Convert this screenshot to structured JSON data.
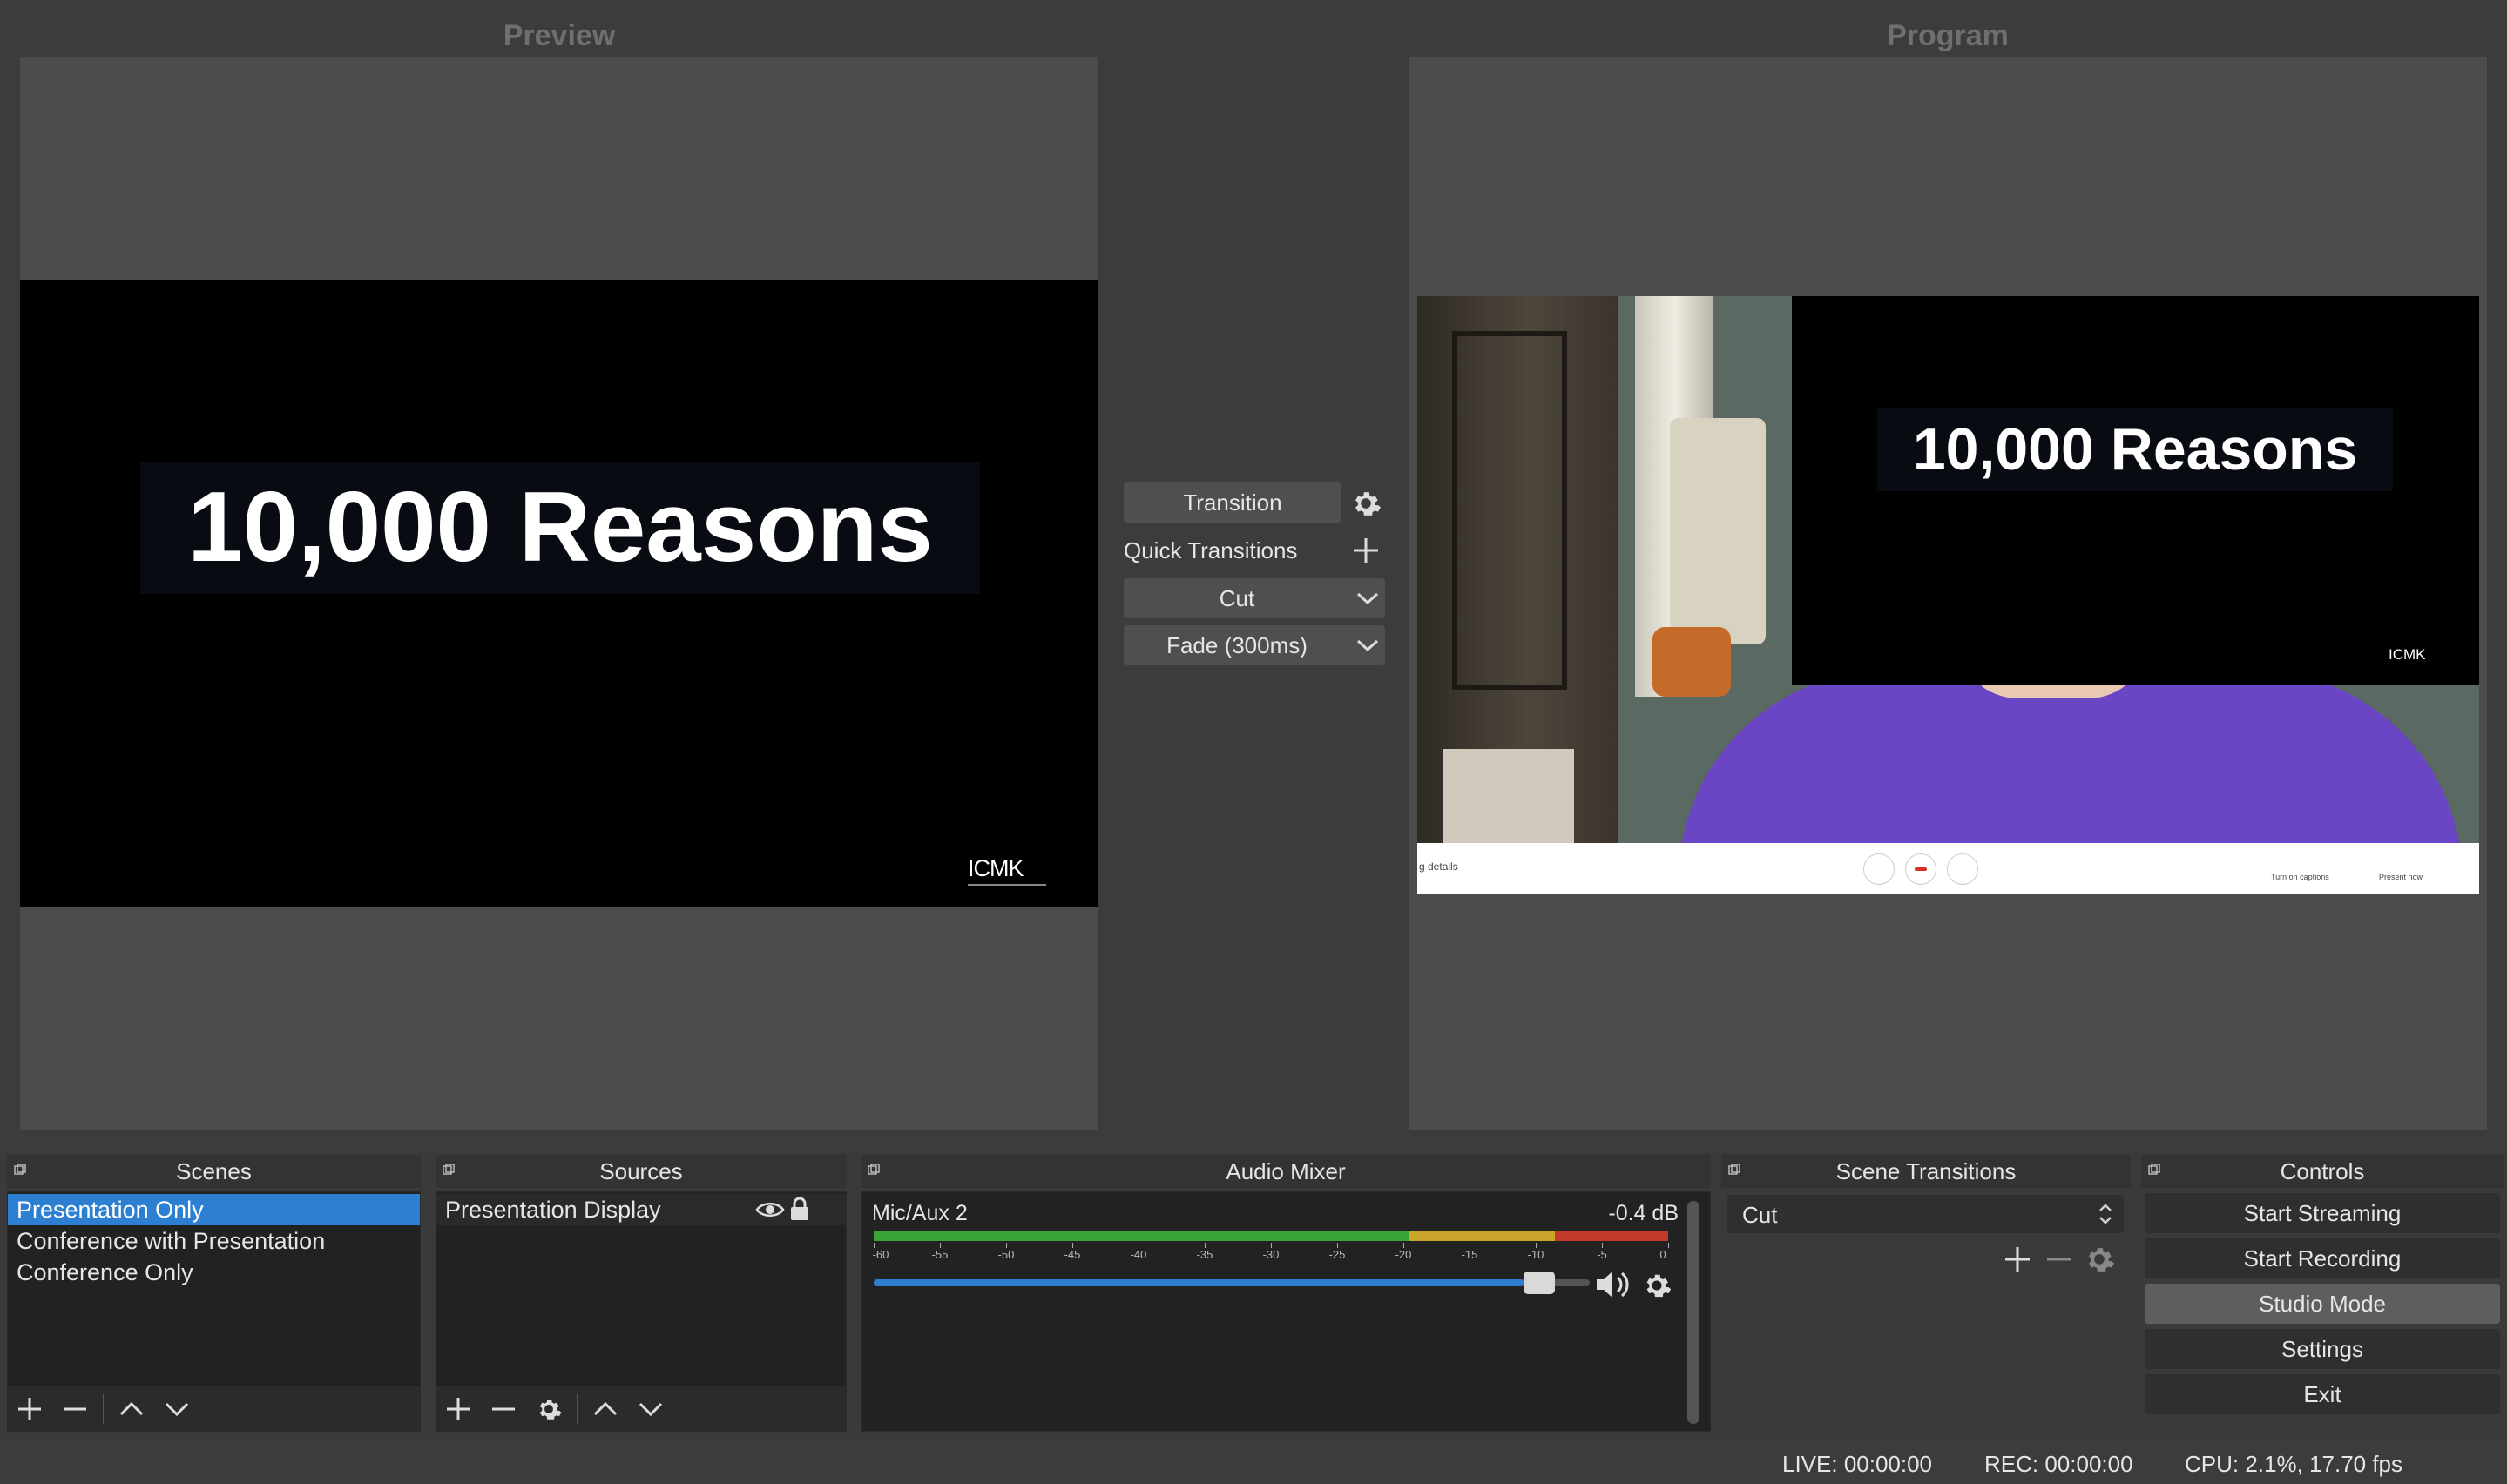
{
  "preview": {
    "title": "Preview",
    "slide_text": "10,000 Reasons",
    "logo_text": "ICMK"
  },
  "program": {
    "title": "Program",
    "slide_text": "10,000 Reasons",
    "logo_text": "ICMK",
    "meet_bar": {
      "details": "g details",
      "captions": "Turn on captions",
      "present": "Present now"
    }
  },
  "transition_panel": {
    "transition_label": "Transition",
    "quick_transitions_label": "Quick Transitions",
    "cut_label": "Cut",
    "fade_label": "Fade (300ms)"
  },
  "scenes": {
    "title": "Scenes",
    "items": [
      "Presentation Only",
      "Conference with Presentation",
      "Conference Only"
    ],
    "selected_index": 0
  },
  "sources": {
    "title": "Sources",
    "items": [
      "Presentation Display"
    ]
  },
  "audio_mixer": {
    "title": "Audio Mixer",
    "channel_name": "Mic/Aux 2",
    "db_value": "-0.4 dB",
    "ticks": [
      "-60",
      "-55",
      "-50",
      "-45",
      "-40",
      "-35",
      "-30",
      "-25",
      "-20",
      "-15",
      "-10",
      "-5",
      "0"
    ],
    "volume_level": 0.93
  },
  "scene_transitions": {
    "title": "Scene Transitions",
    "selected": "Cut"
  },
  "controls": {
    "title": "Controls",
    "buttons": [
      "Start Streaming",
      "Start Recording",
      "Studio Mode",
      "Settings",
      "Exit"
    ],
    "active_index": 2
  },
  "status_bar": {
    "live": "LIVE: 00:00:00",
    "rec": "REC: 00:00:00",
    "cpu": "CPU: 2.1%, 17.70 fps"
  },
  "colors": {
    "accent": "#2d7fd2",
    "meter_green": "#3aa33a",
    "meter_yellow": "#c9a62b",
    "meter_red": "#c0392b",
    "shirt_purple": "#6a45c4"
  }
}
